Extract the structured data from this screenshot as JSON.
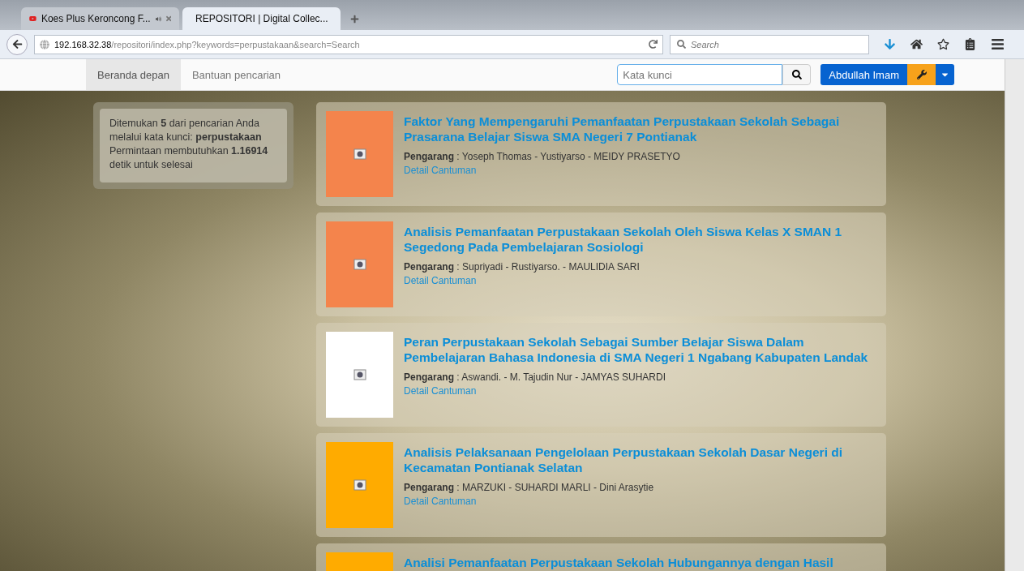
{
  "browser": {
    "tabs": [
      {
        "title": "Koes Plus Keroncong F...",
        "kind": "video",
        "selected": false
      },
      {
        "title": "REPOSITORI | Digital Collec...",
        "kind": "site",
        "selected": true
      }
    ],
    "url_host": "192.168.32.38",
    "url_path": "/repositori/index.php?keywords=perpustakaan&search=Search",
    "search_placeholder": "Search"
  },
  "navbar": {
    "items": [
      {
        "label": "Beranda depan",
        "selected": true
      },
      {
        "label": "Bantuan pencarian",
        "selected": false
      }
    ],
    "search_placeholder": "Kata kunci",
    "user": "Abdullah Imam"
  },
  "summary": "Ditemukan **5** dari pencarian Anda melalui kata kunci: **perpustakaan** Permintaan membutuhkan **1.16914** detik untuk selesai",
  "results": [
    {
      "title": "Faktor Yang Mempengaruhi Pemanfaatan Perpustakaan Sekolah Sebagai Prasarana Belajar Siswa SMA Negeri 7 Pontianak",
      "author_label": "Pengarang",
      "authors": ": Yoseph Thomas - Yustiyarso - MEIDY PRASETYO",
      "link": "Detail Cantuman",
      "color": "#f4844c"
    },
    {
      "title": "Analisis Pemanfaatan Perpustakaan Sekolah Oleh Siswa Kelas X SMAN 1 Segedong Pada Pembelajaran Sosiologi",
      "author_label": "Pengarang",
      "authors": ": Supriyadi - Rustiyarso. - MAULIDIA SARI",
      "link": "Detail Cantuman",
      "color": "#f4844c"
    },
    {
      "title": "Peran Perpustakaan Sekolah Sebagai Sumber Belajar Siswa Dalam Pembelajaran Bahasa Indonesia di SMA Negeri 1 Ngabang Kabupaten Landak",
      "author_label": "Pengarang",
      "authors": ": Aswandi. - M. Tajudin Nur - JAMYAS SUHARDI",
      "link": "Detail Cantuman",
      "color": "#ffffff"
    },
    {
      "title": "Analisis Pelaksanaan Pengelolaan Perpustakaan Sekolah Dasar Negeri di Kecamatan Pontianak Selatan",
      "author_label": "Pengarang",
      "authors": ": MARZUKI - SUHARDI MARLI - Dini Arasytie",
      "link": "Detail Cantuman",
      "color": "#ffab00"
    },
    {
      "title": "Analisi Pemanfaatan Perpustakaan Sekolah Hubungannya dengan Hasil",
      "color": "#ffab00"
    }
  ]
}
